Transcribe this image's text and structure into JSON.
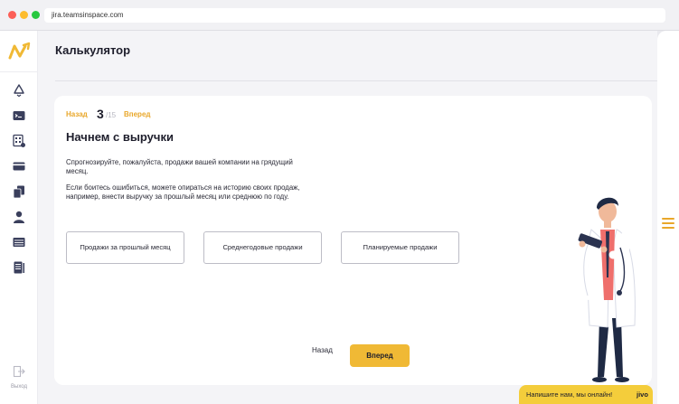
{
  "browser": {
    "url": "jira.teamsinspace.com"
  },
  "sidebar": {
    "items": [
      {
        "icon": "recycle-icon"
      },
      {
        "icon": "terminal-icon"
      },
      {
        "icon": "calculator-icon"
      },
      {
        "icon": "credit-card-icon"
      },
      {
        "icon": "documents-icon"
      },
      {
        "icon": "user-icon"
      },
      {
        "icon": "list-icon"
      },
      {
        "icon": "report-icon"
      }
    ],
    "logout_label": "Выход"
  },
  "page": {
    "title": "Калькулятор"
  },
  "stepper": {
    "back": "Назад",
    "current": "3",
    "total": "/15",
    "forward": "Вперед"
  },
  "content": {
    "heading": "Начнем с выручки",
    "paragraph1": "Спрогнозируйте, пожалуйста, продажи вашей компании на грядущий месяц.",
    "paragraph2": "Если боитесь ошибиться, можете опираться на историю своих продаж, например, внести выручку за прошлый месяц или среднюю по году.",
    "options": [
      "Продажи за прошлый месяц",
      "Среднегодовые продажи",
      "Планируемые продажи"
    ]
  },
  "nav": {
    "back": "Назад",
    "forward": "Вперед"
  },
  "chat": {
    "text": "Напишите нам, мы онлайн!",
    "brand": "jivo"
  },
  "colors": {
    "accent": "#f0b935",
    "accent_text": "#e9a72a"
  }
}
